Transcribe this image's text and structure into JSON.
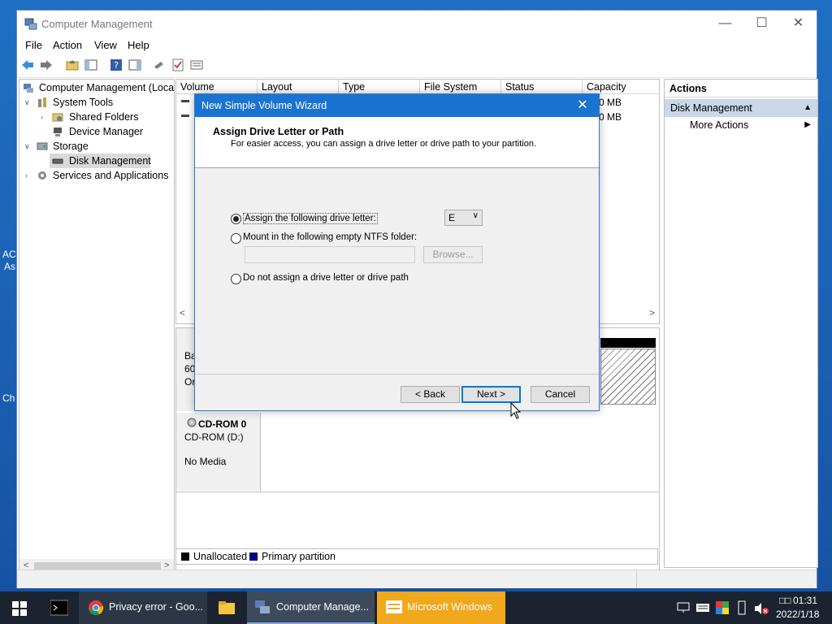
{
  "desktop": {
    "left_labels": [
      "AC",
      "As",
      "Ch"
    ]
  },
  "window": {
    "title": "Computer Management",
    "controls": {
      "minimize": "—",
      "maximize": "☐",
      "close": "✕"
    },
    "menu": [
      "File",
      "Action",
      "View",
      "Help"
    ]
  },
  "tree": {
    "root": "Computer Management (Local",
    "system_tools": "System Tools",
    "shared_folders": "Shared Folders",
    "device_manager": "Device Manager",
    "storage": "Storage",
    "disk_management": "Disk Management",
    "services": "Services and Applications"
  },
  "volumes": {
    "columns": [
      "Volume",
      "Layout",
      "Type",
      "File System",
      "Status",
      "Capacity"
    ],
    "capacity_cells": [
      "0 MB",
      "0 MB"
    ]
  },
  "disks": {
    "disk0_partial": [
      "Ba",
      "60.",
      "Or"
    ],
    "cdrom_name": "CD-ROM 0",
    "cdrom_type": "CD-ROM (D:)",
    "cdrom_media": "No Media"
  },
  "legend": {
    "unallocated": "Unallocated",
    "primary": "Primary partition"
  },
  "actions": {
    "header": "Actions",
    "section": "Disk Management",
    "more": "More Actions"
  },
  "dialog": {
    "title": "New Simple Volume Wizard",
    "heading": "Assign Drive Letter or Path",
    "subheading": "For easier access, you can assign a drive letter or drive path to your partition.",
    "option_assign": "Assign the following drive letter:",
    "option_mount": "Mount in the following empty NTFS folder:",
    "option_none": "Do not assign a drive letter or drive path",
    "drive_letter": "E",
    "browse": "Browse...",
    "back": "< Back",
    "next": "Next >",
    "cancel": "Cancel"
  },
  "taskbar": {
    "items": [
      "Privacy error - Goo...",
      "Computer Manage...",
      "Microsoft Windows"
    ],
    "time": "01:31",
    "time_prefix": "□□",
    "date": "2022/1/18"
  },
  "colors": {
    "accent": "#1a73d0",
    "taskbar_active": "#f0a81c",
    "selection": "#c9d7e8"
  }
}
